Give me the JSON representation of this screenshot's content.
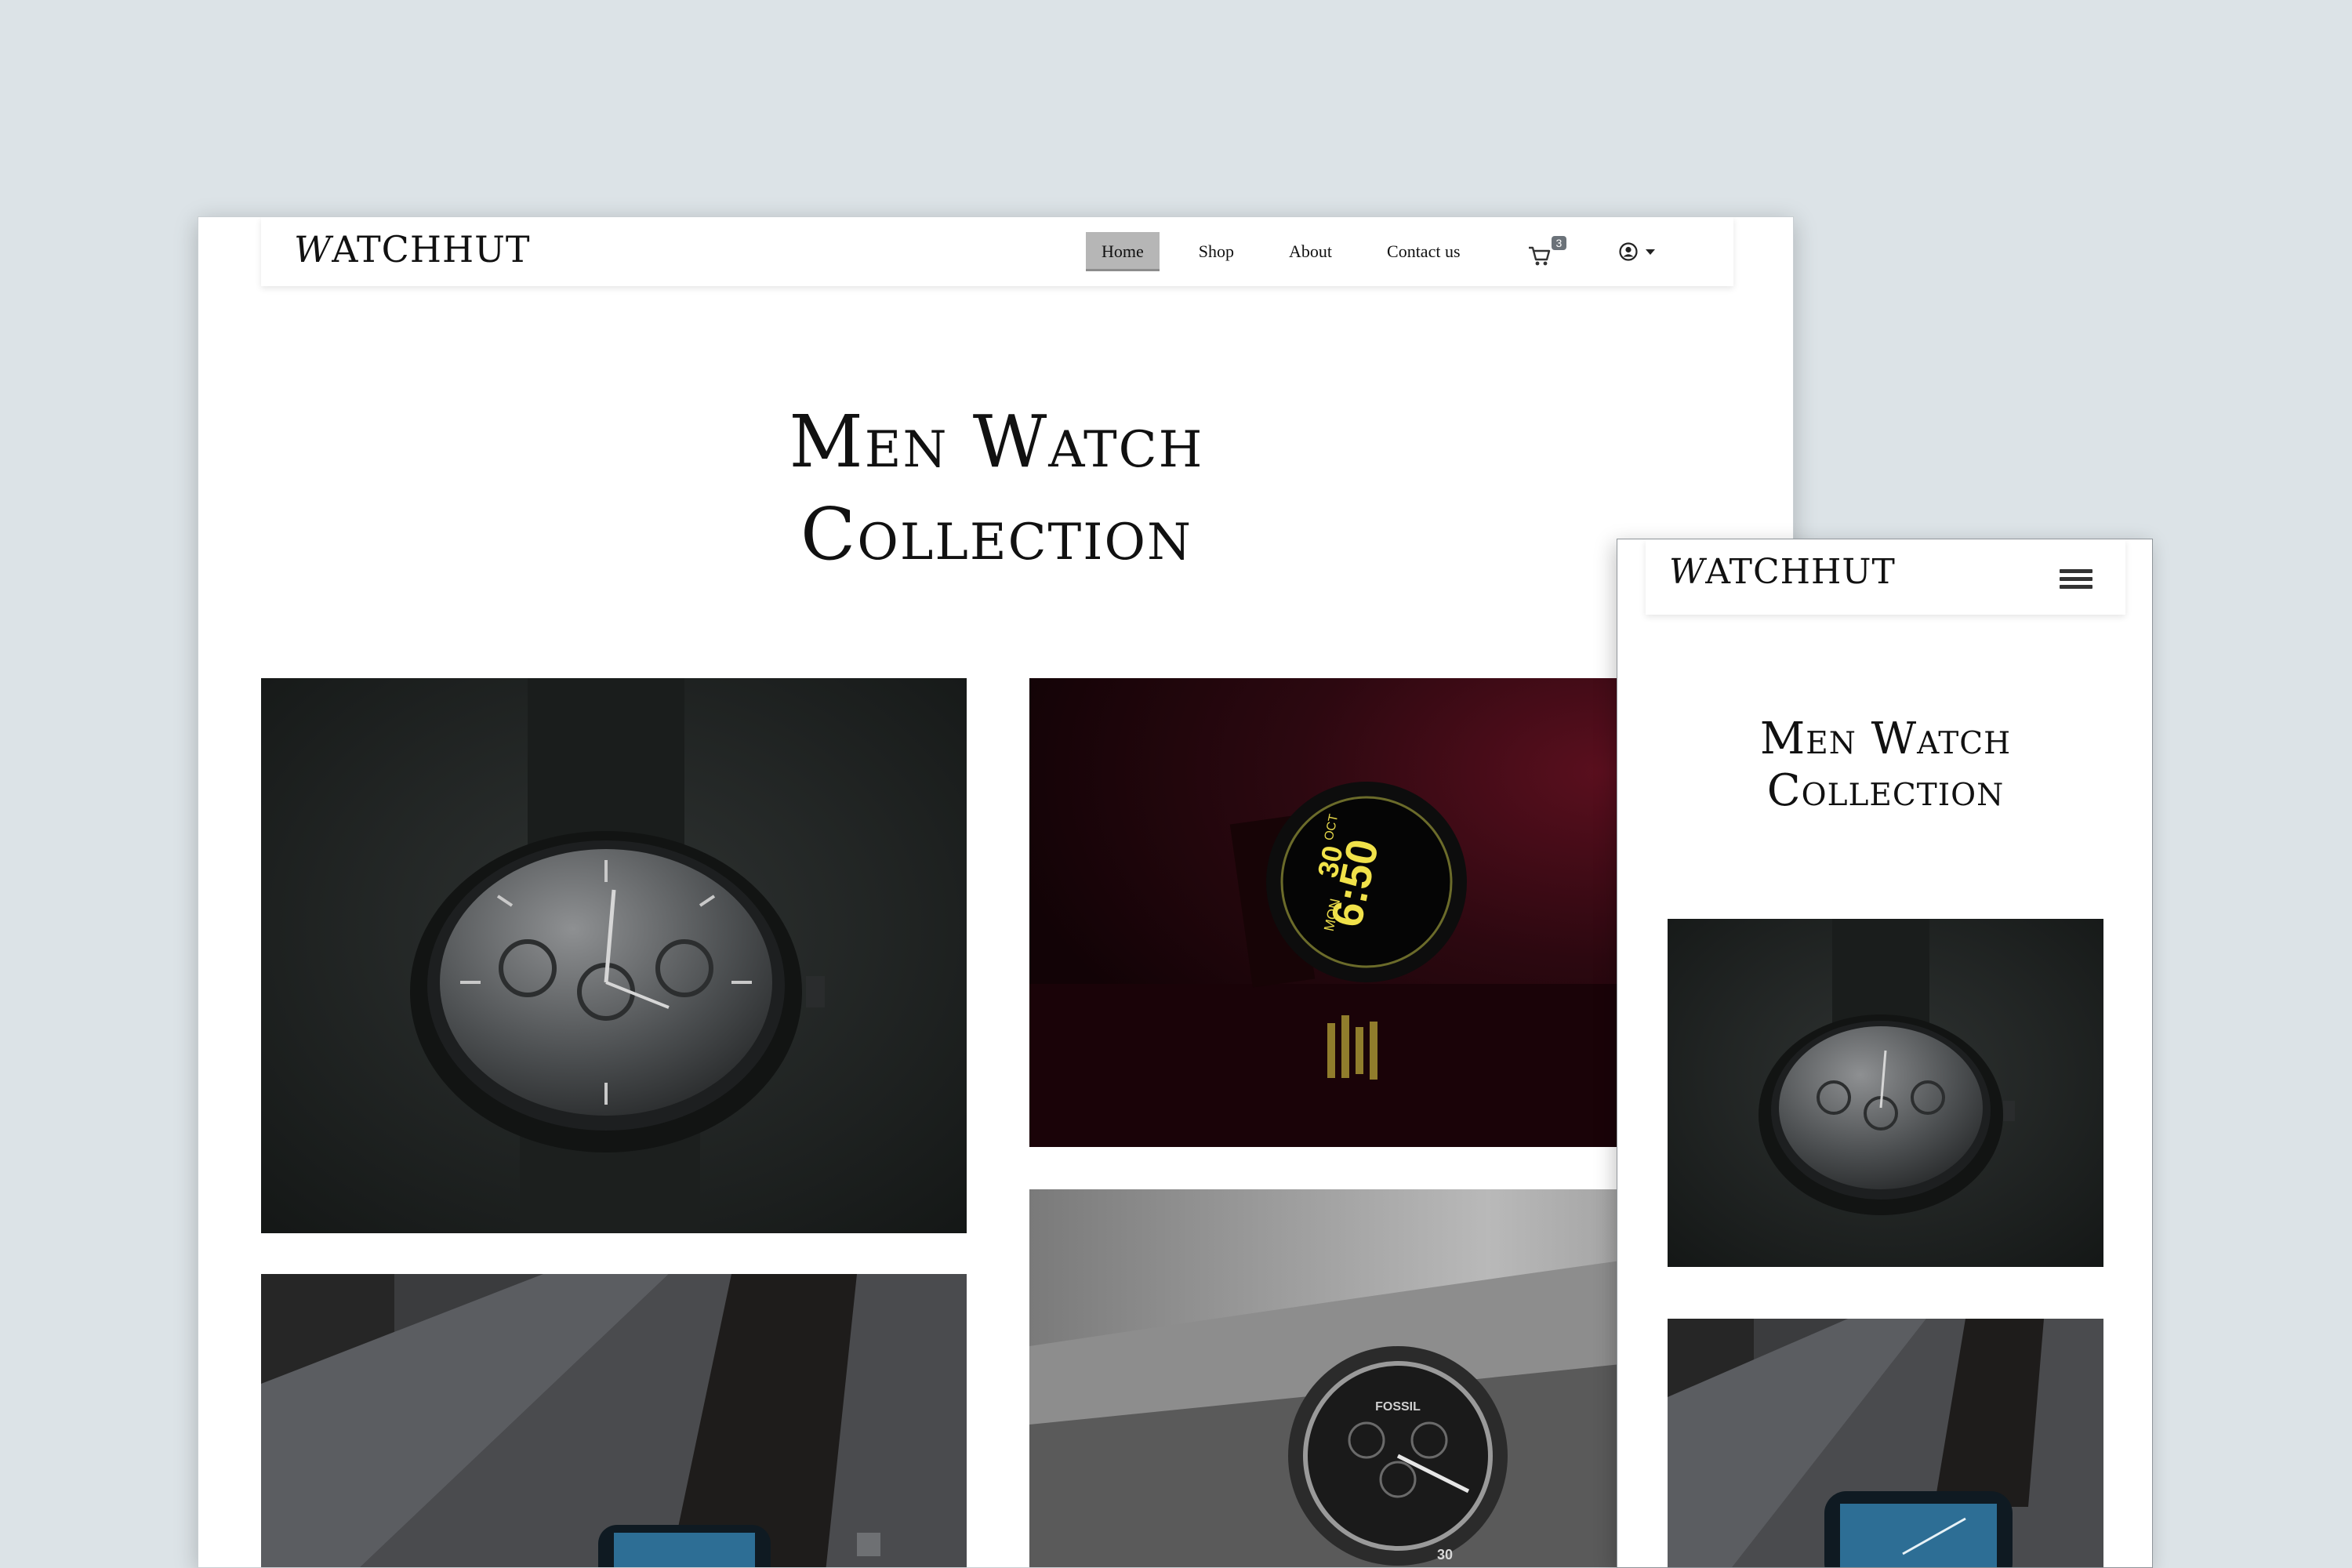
{
  "desktop": {
    "brand": {
      "cap": "W",
      "rest": "ATCHHUT"
    },
    "nav": {
      "items": [
        {
          "label": "Home",
          "active": true
        },
        {
          "label": "Shop",
          "active": false
        },
        {
          "label": "About",
          "active": false
        },
        {
          "label": "Contact us",
          "active": false
        }
      ],
      "cart_count": "3",
      "cart_icon": "cart-icon",
      "user_icon": "user-circle-icon"
    },
    "heading": {
      "line1": "Men Watch",
      "line2": "Collection"
    },
    "products": [
      {
        "name": "black-chronograph-watch-photo",
        "tone": "dark"
      },
      {
        "name": "smartwatch-red-light-photo",
        "tone": "red"
      },
      {
        "name": "leather-strap-smartwatch-photo",
        "tone": "dark"
      },
      {
        "name": "fossil-chronograph-wrist-photo",
        "tone": "gray"
      }
    ]
  },
  "mobile": {
    "brand": {
      "cap": "W",
      "rest": "ATCHHUT"
    },
    "menu_icon": "hamburger-icon",
    "heading": {
      "line1": "Men Watch",
      "line2": "Collection"
    }
  },
  "watch_faces": {
    "smart_time": "6:50",
    "smart_day": "MON",
    "smart_date": "30",
    "smart_month": "OCT",
    "fossil_brand": "FOSSIL",
    "fossil_marker": "30"
  },
  "colors": {
    "backdrop": "#dce3e7",
    "active_nav": "#b6b6b6",
    "badge": "#6b7279",
    "text": "#111111"
  }
}
